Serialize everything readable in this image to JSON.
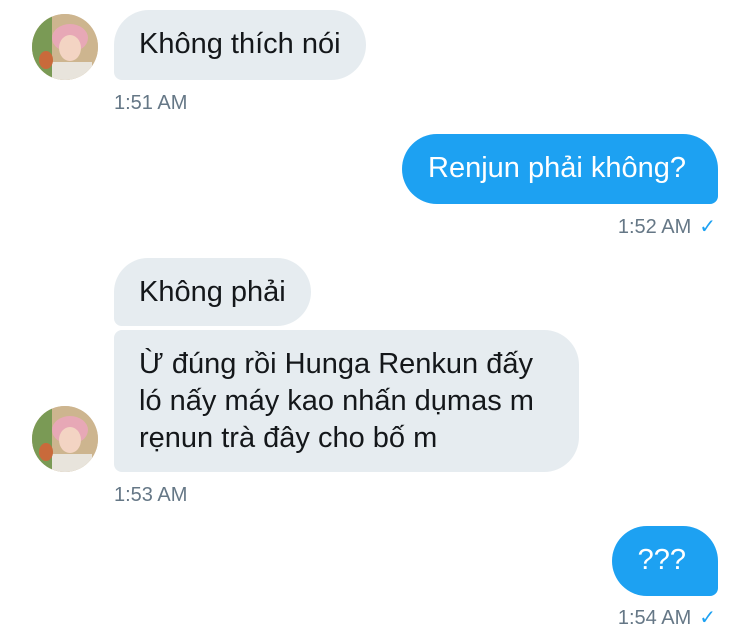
{
  "messages": [
    {
      "side": "in",
      "text": "Không thích nói"
    },
    {
      "side": "out",
      "text": "Renjun phải không?"
    },
    {
      "side": "in",
      "text": "Không phải"
    },
    {
      "side": "in",
      "lines": [
        "Ừ đúng rồi Hunga Renkun đấy",
        "ló nấy máy kao nhấn dụmas m",
        "rẹnun trà đây cho bố m"
      ]
    },
    {
      "side": "out",
      "text": "???"
    }
  ],
  "timestamps": [
    "1:51 AM",
    "1:52 AM",
    "1:53 AM",
    "1:54 AM"
  ],
  "read_icon": "checkmark-icon",
  "colors": {
    "incoming": "#e6ecf0",
    "outgoing": "#1da1f2",
    "meta": "#657786"
  }
}
